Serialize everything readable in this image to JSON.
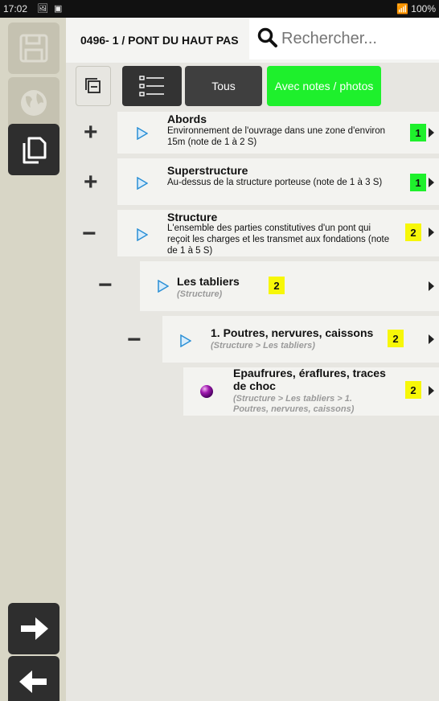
{
  "statusbar": {
    "time": "17:02",
    "left_icons": "🖼 ▣",
    "right": "📶 100%"
  },
  "header": {
    "bridge_title": "0496- 1 / PONT DU HAUT PAS",
    "search_placeholder": "Rechercher..."
  },
  "toolbar": {
    "tous_label": "Tous",
    "notes_label": "Avec notes / photos"
  },
  "tree": [
    {
      "title": "Abords",
      "desc": "Environnement de l'ouvrage dans une zone d'environ 15m (note de 1 à 2 S)",
      "note": "1",
      "toggle": "+",
      "badge_color": "#1ef02c"
    },
    {
      "title": "Superstructure",
      "desc": "Au-dessus de la structure porteuse (note de 1 à 3 S)",
      "note": "1",
      "toggle": "+",
      "badge_color": "#1ef02c"
    },
    {
      "title": "Structure",
      "desc": "L'ensemble des parties constitutives d'un pont qui reçoit les charges et les transmet aux fondations (note de 1 à 5 S)",
      "note": "2",
      "toggle": "−",
      "badge_color": "#f7f708"
    },
    {
      "title": "Les tabliers",
      "path": "(Structure)",
      "note": "2",
      "toggle": "−",
      "badge_color": "#f7f708"
    },
    {
      "title": "1. Poutres, nervures, caissons",
      "path": "(Structure > Les tabliers)",
      "note": "2",
      "toggle": "−",
      "badge_color": "#f7f708"
    },
    {
      "title": "Epaufrures, éraflures, traces de choc",
      "path": "(Structure > Les tabliers > 1. Poutres, nervures, caissons)",
      "note": "2",
      "badge_color": "#f7f708"
    }
  ]
}
